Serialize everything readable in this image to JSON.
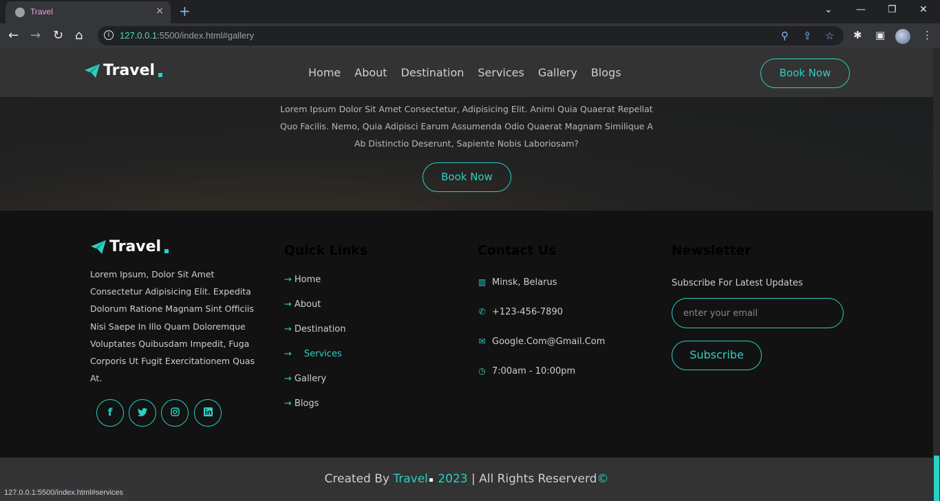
{
  "browser": {
    "tab_title": "Travel",
    "tab_close": "×",
    "new_tab": "+",
    "url_host": "127.0.0.1",
    "url_rest": ":5500/index.html#gallery",
    "status_url": "127.0.0.1:5500/index.html#services"
  },
  "header": {
    "logo_text": "Travel",
    "nav": [
      "Home",
      "About",
      "Destination",
      "Services",
      "Gallery",
      "Blogs"
    ],
    "book_label": "Book Now"
  },
  "hero": {
    "paragraph": "Lorem Ipsum Dolor Sit Amet Consectetur, Adipisicing Elit. Animi Quia Quaerat Repellat Quo Facilis. Nemo, Quia Adipisci Earum Assumenda Odio Quaerat Magnam Similique A Ab Distinctio Deserunt, Sapiente Nobis Laboriosam?",
    "book_label": "Book Now"
  },
  "footer": {
    "logo_text": "Travel",
    "about": "Lorem Ipsum, Dolor Sit Amet Consectetur Adipisicing Elit. Expedita Dolorum Ratione Magnam Sint Officiis Nisi Saepe In Illo Quam Doloremque Voluptates Quibusdam Impedit, Fuga Corporis Ut Fugit Exercitationem Quas At.",
    "quick_links_title": "Quick Links",
    "quick_links": [
      "Home",
      "About",
      "Destination",
      "Services",
      "Gallery",
      "Blogs"
    ],
    "contact_title": "Contact Us",
    "contact": {
      "location": "Minsk, Belarus",
      "phone": "+123-456-7890",
      "email": "Google.Com@Gmail.Com",
      "hours": "7:00am - 10:00pm"
    },
    "newsletter_title": "Newsletter",
    "newsletter_sub": "Subscribe For Latest Updates",
    "email_placeholder": "enter your email",
    "subscribe_label": "Subscribe",
    "social": [
      "facebook-icon",
      "twitter-icon",
      "instagram-icon",
      "linkedin-icon"
    ]
  },
  "credit": {
    "prefix": "Created By ",
    "brand": "Travel",
    "year": " 2023",
    "suffix": " | All Rights Reserverd",
    "copyright": "©"
  },
  "colors": {
    "accent": "#2bd0c4",
    "header_bg": "#333333",
    "footer_bg": "#121212"
  }
}
